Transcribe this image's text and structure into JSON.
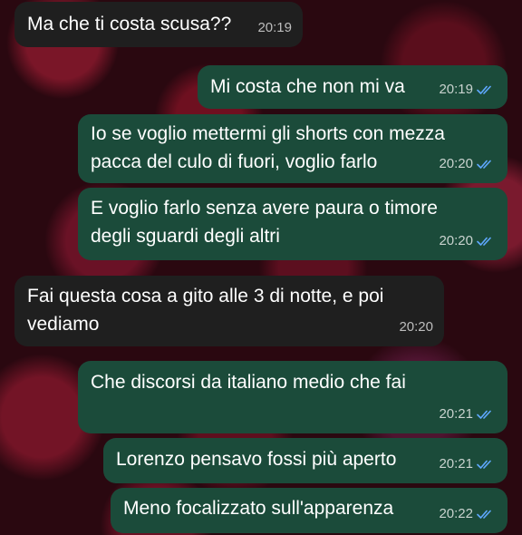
{
  "messages": [
    {
      "text": "Ma che ti costa scusa??",
      "time": "20:19",
      "dir": "in"
    },
    {
      "text": "Mi costa che non mi va",
      "time": "20:19",
      "dir": "out",
      "read": true
    },
    {
      "text": "Io se voglio mettermi gli shorts con mezza\npacca del culo di fuori, voglio farlo",
      "time": "20:20",
      "dir": "out",
      "read": true
    },
    {
      "text": "E voglio farlo senza avere paura o timore\ndegli sguardi degli altri",
      "time": "20:20",
      "dir": "out",
      "read": true
    },
    {
      "text": "Fai questa cosa a gito alle 3 di notte, e poi\nvediamo",
      "time": "20:20",
      "dir": "in"
    },
    {
      "text": "Che discorsi da italiano medio che fai",
      "time": "20:21",
      "dir": "out",
      "read": true
    },
    {
      "text": "Lorenzo pensavo fossi più aperto",
      "time": "20:21",
      "dir": "out",
      "read": true
    },
    {
      "text": "Meno focalizzato sull'apparenza",
      "time": "20:22",
      "dir": "out",
      "read": true
    }
  ],
  "colors": {
    "incoming_bubble": "#1f1f1f",
    "outgoing_bubble": "#1b4b3a",
    "read_ticks": "#5fa8ff"
  },
  "icons": {
    "read_receipt": "double-check-icon"
  }
}
